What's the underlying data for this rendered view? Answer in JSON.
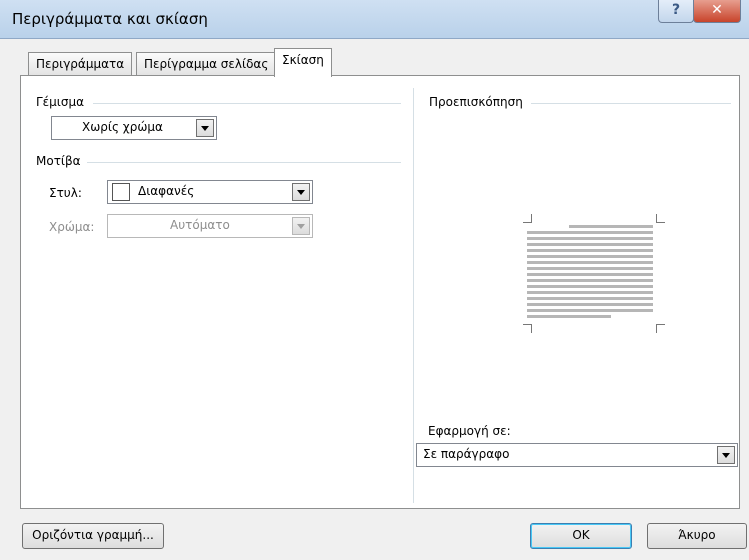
{
  "window": {
    "title": "Περιγράμματα και σκίαση",
    "help_glyph": "?",
    "close_glyph": "✕"
  },
  "tabs": [
    {
      "label": "Περιγράμματα"
    },
    {
      "label": "Περίγραμμα σελίδας"
    },
    {
      "label": "Σκίαση"
    }
  ],
  "fill": {
    "heading": "Γέμισμα",
    "value": "Χωρίς χρώμα"
  },
  "patterns": {
    "heading": "Μοτίβα",
    "style_label": "Στυλ:",
    "style_value": "Διαφανές",
    "color_label": "Χρώμα:",
    "color_value": "Αυτόματο"
  },
  "preview": {
    "heading": "Προεπισκόπηση",
    "line_color": "#b6b6b6"
  },
  "apply_to": {
    "label": "Εφαρμογή σε:",
    "value": "Σε παράγραφο"
  },
  "buttons": {
    "horizontal_line": "Οριζόντια γραμμή...",
    "ok": "OK",
    "cancel": "Άκυρο"
  }
}
